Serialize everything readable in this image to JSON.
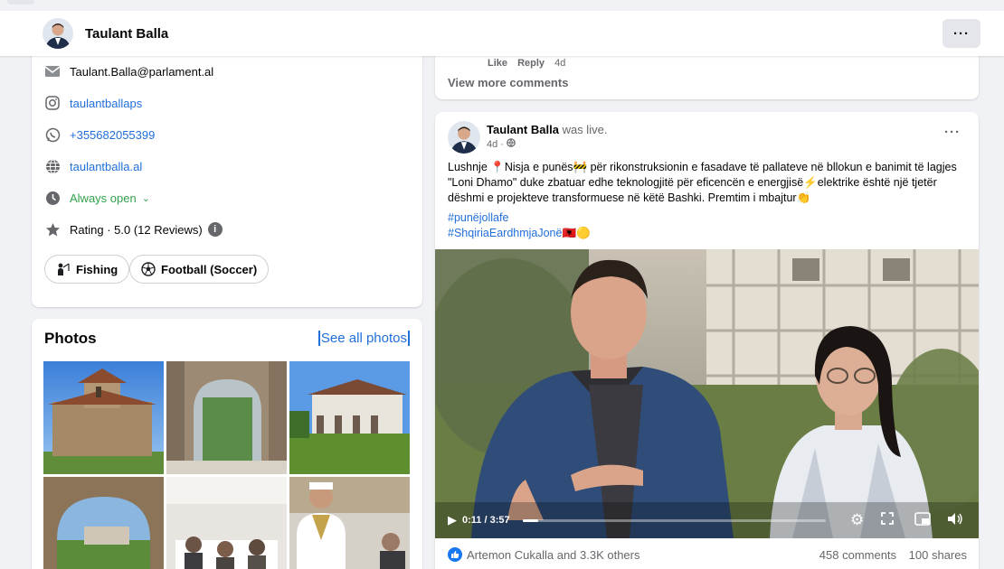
{
  "header": {
    "name": "Taulant Balla",
    "more_label": "···"
  },
  "intro": {
    "email": "Taulant.Balla@parlament.al",
    "instagram": "taulantballaps",
    "phone": "+355682055399",
    "website": "taulantballa.al",
    "hours": "Always open",
    "rating": "Rating · 5.0 (12 Reviews)",
    "interests": [
      "Fishing",
      "Football (Soccer)"
    ]
  },
  "photos": {
    "title": "Photos",
    "see_all": "See all photos"
  },
  "comments": {
    "like": "Like",
    "reply": "Reply",
    "age": "4d",
    "view_more": "View more comments"
  },
  "post": {
    "author": "Taulant Balla",
    "action": "was live.",
    "time": "4d ·",
    "more_label": "···",
    "text": "Lushnje 📍Nisja e punës🚧 për rikonstruksionin e fasadave të pallateve në bllokun e banimit të lagjes \"Loni Dhamo\" duke zbatuar edhe teknologjitë për eficencën e energjisë⚡elektrike është një tjetër dëshmi e projekteve transformuese në këtë Bashki. Premtim i mbajtur👏",
    "hashtag1": "#punëjollafe",
    "hashtag2": "#ShqiriaEardhmjaJonë🇦🇱🟡",
    "video_time": "0:11 / 3:57",
    "progress": 0.05,
    "reactions": "Artemon Cukalla and 3.3K others",
    "comments": "458 comments",
    "shares": "100 shares"
  },
  "colors": {
    "link": "#216fdb",
    "green": "#31a24c",
    "brand": "#1877f2"
  }
}
